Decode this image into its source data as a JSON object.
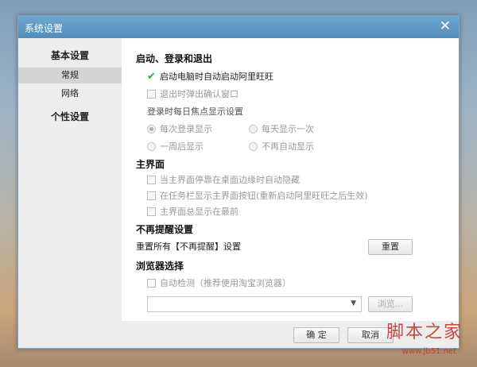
{
  "window": {
    "title": "系统设置",
    "close_glyph": "✕"
  },
  "sidebar": {
    "groups": [
      {
        "label": "基本设置",
        "items": [
          {
            "label": "常规"
          },
          {
            "label": "网络"
          }
        ]
      },
      {
        "label": "个性设置"
      }
    ]
  },
  "startup": {
    "title": "启动、登录和退出",
    "auto_start": "启动电脑时自动启动阿里旺旺",
    "exit_confirm": "退出时弹出确认窗口",
    "focus_label": "登录时每日焦点显示设置",
    "radios": [
      "每次登录显示",
      "每天显示一次",
      "一周后显示",
      "不再自动显示"
    ]
  },
  "main_ui": {
    "title": "主界面",
    "options": [
      "当主界面停靠在桌面边缘时自动隐藏",
      "在任务栏显示主界面按钮(重新启动阿里旺旺之后生效)",
      "主界面总显示在最前"
    ]
  },
  "reminder": {
    "title": "不再提醒设置",
    "reset_text": "重置所有【不再提醒】设置",
    "reset_button": "重置"
  },
  "browser": {
    "title": "浏览器选择",
    "auto_detect": "自动检测（推荐使用淘宝浏览器）",
    "browse_button": "浏览..."
  },
  "footer": {
    "ok": "确 定",
    "cancel": "取消"
  },
  "watermark": {
    "main": "脚本之家",
    "sub": "www.jb51.net"
  },
  "colors": {
    "titlebar": "#5b97c4",
    "check": "#2aa84a",
    "watermark": "#c0392b"
  }
}
